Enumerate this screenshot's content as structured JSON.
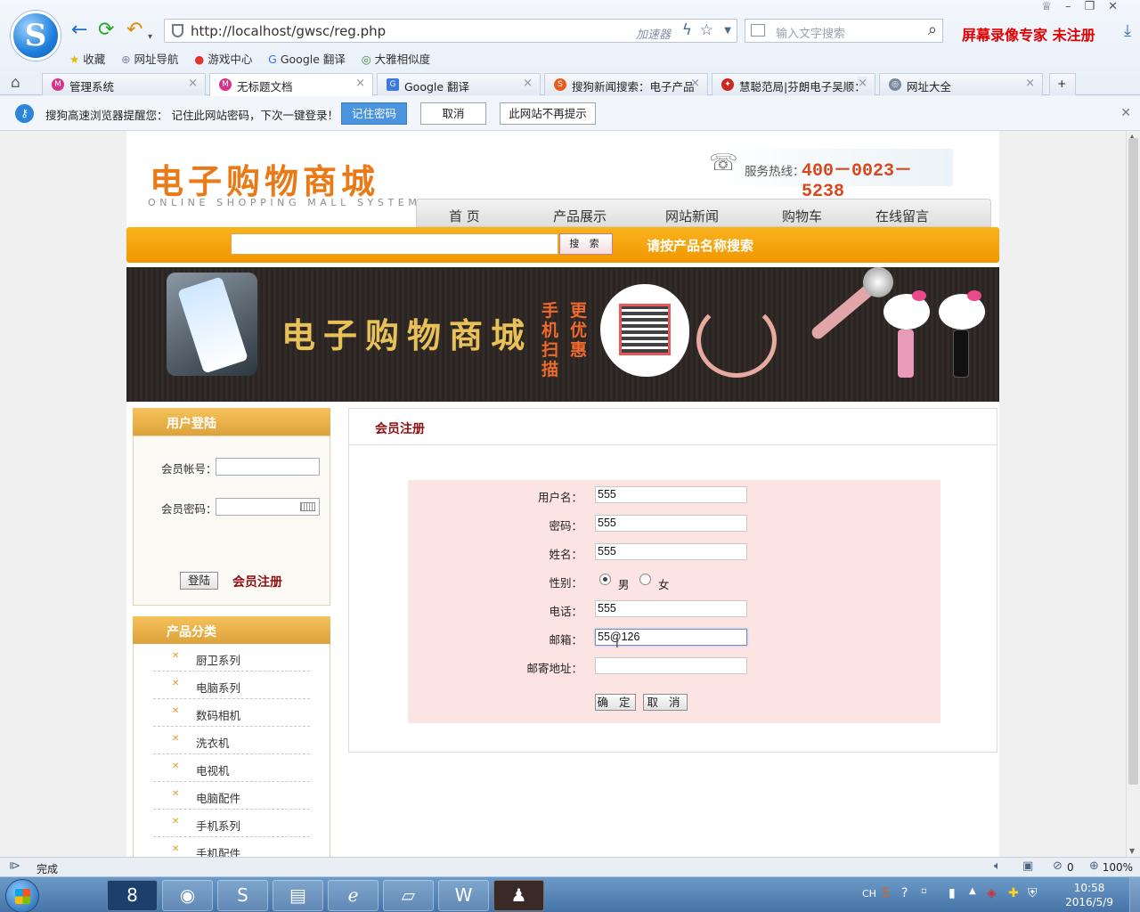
{
  "browser": {
    "url": "http://localhost/gwsc/reg.php",
    "accelerator": "加速器",
    "search_placeholder": "输入文字搜索",
    "overlay_title": "屏幕录像专家  未注册",
    "bookmarks": [
      "收藏",
      "网址导航",
      "游戏中心",
      "Google 翻译",
      "大雅相似度"
    ],
    "tabs": [
      {
        "label": "管理系统",
        "active": false
      },
      {
        "label": "无标题文档",
        "active": true
      },
      {
        "label": "Google 翻译",
        "active": false
      },
      {
        "label": "搜狗新闻搜索：电子产品",
        "active": false
      },
      {
        "label": "慧聪范局|芬朗电子吴顺：",
        "active": false
      },
      {
        "label": "网址大全",
        "active": false
      }
    ],
    "notice": {
      "text": "搜狗高速浏览器提醒您： 记住此网站密码，下次一键登录！",
      "remember": "记住密码",
      "cancel": "取消",
      "never": "此网站不再提示"
    },
    "status": "完成",
    "security_count": "0",
    "zoom": "100%"
  },
  "site": {
    "logo": "电子购物商城",
    "logo_en": "ONLINE SHOPPING MALL SYSTEM",
    "hotline_label": "服务热线：",
    "hotline_number": "400－0023－5238",
    "nav": [
      "首 页",
      "产品展示",
      "网站新闻",
      "购物车",
      "在线留言"
    ],
    "search_button": "搜 索",
    "search_hint": "请按产品名称搜索",
    "banner": {
      "title": "电子购物商城",
      "vertical_1": "手机扫描",
      "vertical_2": "更优惠"
    }
  },
  "login": {
    "title": "用户登陆",
    "account_label": "会员帐号：",
    "password_label": "会员密码：",
    "login_button": "登陆",
    "register_link": "会员注册"
  },
  "categories": {
    "title": "产品分类",
    "items": [
      "厨卫系列",
      "电脑系列",
      "数码相机",
      "洗衣机",
      "电视机",
      "电脑配件",
      "手机系列",
      "手机配件"
    ]
  },
  "register": {
    "title": "会员注册",
    "fields": [
      {
        "label": "用户名：",
        "value": "555"
      },
      {
        "label": "密码：",
        "value": "555"
      },
      {
        "label": "姓名：",
        "value": "555"
      },
      {
        "label": "电话：",
        "value": "555"
      },
      {
        "label": "邮箱：",
        "value": "55@126"
      },
      {
        "label": "邮寄地址：",
        "value": ""
      }
    ],
    "gender_label": "性别：",
    "gender_options": [
      "男",
      "女"
    ],
    "gender_selected": "男",
    "confirm": "确 定",
    "cancel": "取 消"
  },
  "taskbar": {
    "lang": "CH",
    "time": "10:58",
    "date": "2016/5/9"
  }
}
